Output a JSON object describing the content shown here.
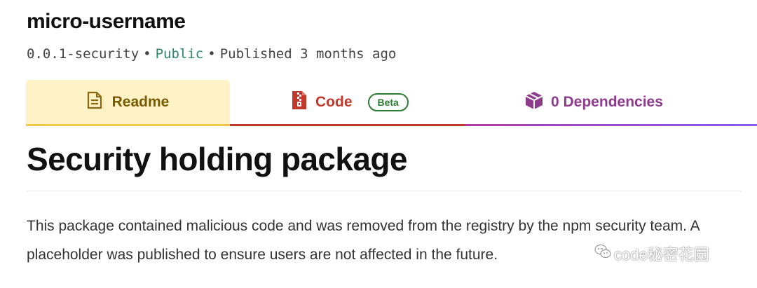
{
  "package": {
    "name": "micro-username",
    "version": "0.0.1-security",
    "visibility": "Public",
    "published": "Published 3 months ago",
    "separator": "•"
  },
  "tabs": [
    {
      "label": "Readme",
      "icon": "document-icon",
      "color": "#7a5a00"
    },
    {
      "label": "Code",
      "icon": "zip-file-icon",
      "color": "#c0392b",
      "badge": "Beta"
    },
    {
      "label": "0 Dependencies",
      "icon": "package-box-icon",
      "color": "#8e3b8e"
    }
  ],
  "readme": {
    "heading": "Security holding package",
    "paragraph": "This package contained malicious code and was removed from the registry by the npm security team. A placeholder was published to ensure users are not affected in the future."
  },
  "watermark": {
    "text": "code秘密花园",
    "icon": "wechat-icon"
  }
}
